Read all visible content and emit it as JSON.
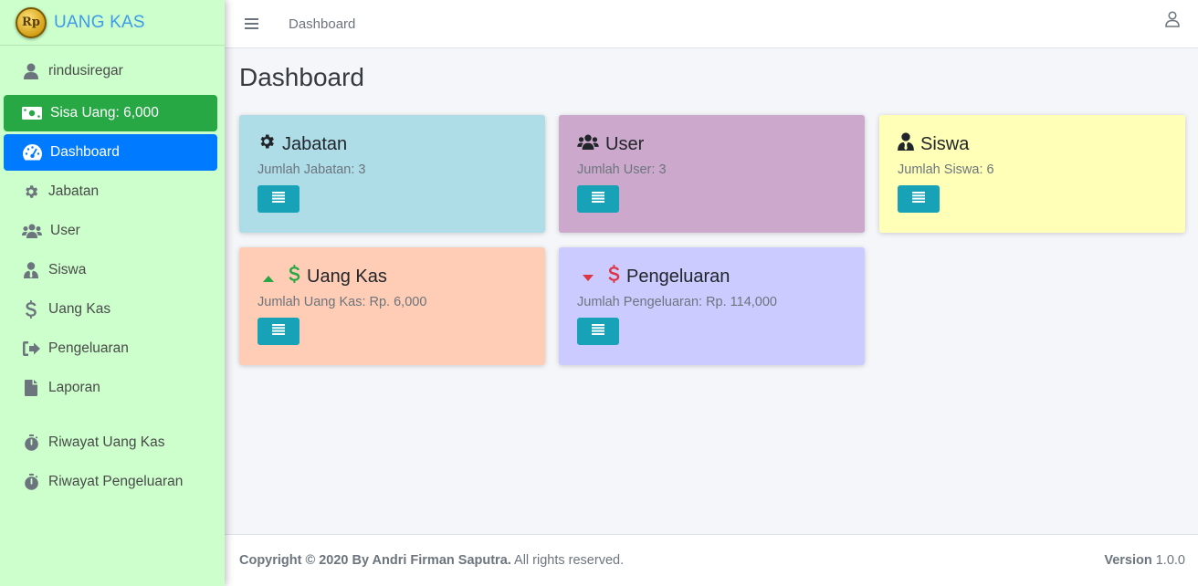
{
  "brand": {
    "logo_text": "Rp",
    "name": "UANG KAS"
  },
  "sidebar": {
    "username": "rindusiregar",
    "balance": "Sisa Uang: 6,000",
    "items": [
      {
        "label": "Dashboard"
      },
      {
        "label": "Jabatan"
      },
      {
        "label": "User"
      },
      {
        "label": "Siswa"
      },
      {
        "label": "Uang Kas"
      },
      {
        "label": "Pengeluaran"
      },
      {
        "label": "Laporan"
      },
      {
        "label": "Riwayat Uang Kas"
      },
      {
        "label": "Riwayat Pengeluaran"
      }
    ]
  },
  "navbar": {
    "breadcrumb": "Dashboard"
  },
  "main": {
    "title": "Dashboard",
    "cards": [
      {
        "title": "Jabatan",
        "text": "Jumlah Jabatan: 3",
        "color": "#aedce7"
      },
      {
        "title": "User",
        "text": "Jumlah User: 3",
        "color": "#cca9cc"
      },
      {
        "title": "Siswa",
        "text": "Jumlah Siswa: 6",
        "color": "#ffffb8"
      },
      {
        "title": "Uang Kas",
        "text": "Jumlah Uang Kas: Rp. 6,000",
        "color": "#ffccb5"
      },
      {
        "title": "Pengeluaran",
        "text": "Jumlah Pengeluaran: Rp. 114,000",
        "color": "#cccbff"
      }
    ]
  },
  "footer": {
    "copyright_bold": "Copyright © 2020 By Andri Firman Saputra.",
    "copyright_rest": " All rights reserved.",
    "version_label": "Version",
    "version_value": " 1.0.0"
  },
  "colors": {
    "sidebar_bg": "#ccffcc",
    "success": "#28a745",
    "primary": "#007bff",
    "button": "#17a2b8"
  }
}
